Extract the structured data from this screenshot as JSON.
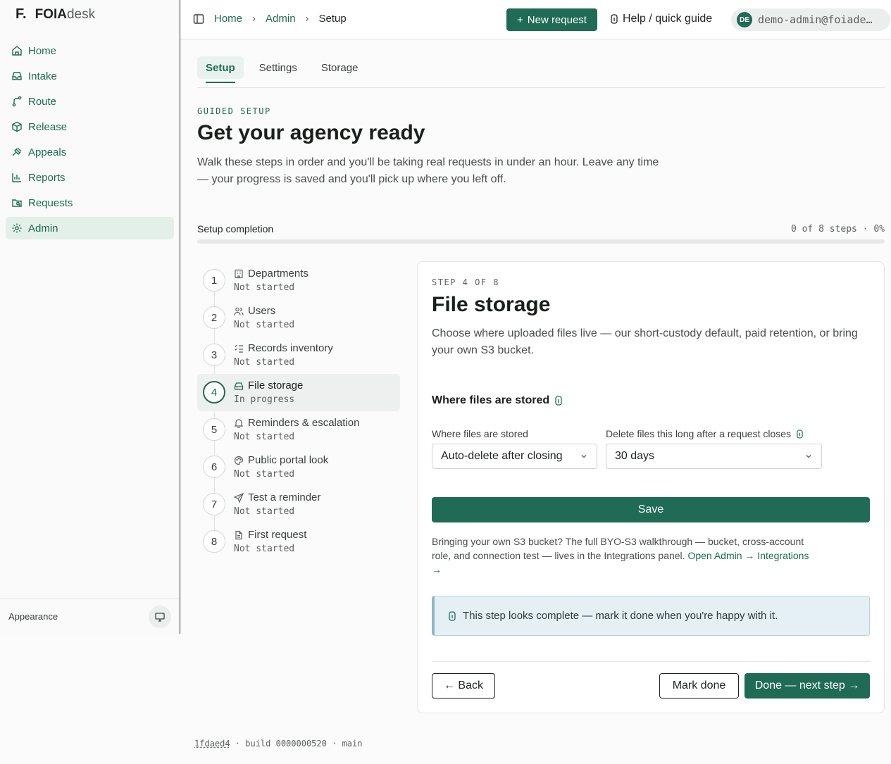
{
  "brand": {
    "mark": "F.",
    "name_bold": "FOIA",
    "name_light": "desk"
  },
  "nav": [
    {
      "label": "Home",
      "icon": "home-icon"
    },
    {
      "label": "Intake",
      "icon": "inbox-icon"
    },
    {
      "label": "Route",
      "icon": "route-icon"
    },
    {
      "label": "Release",
      "icon": "package-icon"
    },
    {
      "label": "Appeals",
      "icon": "gavel-icon"
    },
    {
      "label": "Reports",
      "icon": "bar-chart-icon"
    },
    {
      "label": "Requests",
      "icon": "folder-search-icon"
    },
    {
      "label": "Admin",
      "icon": "gear-icon",
      "active": true
    }
  ],
  "sidebar_footer": {
    "appearance_label": "Appearance"
  },
  "breadcrumb": {
    "home": "Home",
    "admin": "Admin",
    "current": "Setup"
  },
  "topbar": {
    "new_request": "New request",
    "help": "Help / quick guide",
    "avatar_initials": "DE",
    "user_email": "demo-admin@foiade…"
  },
  "tabs": [
    {
      "label": "Setup",
      "active": true
    },
    {
      "label": "Settings"
    },
    {
      "label": "Storage"
    }
  ],
  "page": {
    "eyebrow": "GUIDED SETUP",
    "title": "Get your agency ready",
    "lead": "Walk these steps in order and you'll be taking real requests in under an hour. Leave any time — your progress is saved and you'll pick up where you left off."
  },
  "progress": {
    "label": "Setup completion",
    "count_text": "0 of 8 steps · 0%",
    "fraction": 0
  },
  "steps": [
    {
      "num": "1",
      "label": "Departments",
      "state": "Not started",
      "icon": "building-icon"
    },
    {
      "num": "2",
      "label": "Users",
      "state": "Not started",
      "icon": "users-icon"
    },
    {
      "num": "3",
      "label": "Records inventory",
      "state": "Not started",
      "icon": "list-checks-icon"
    },
    {
      "num": "4",
      "label": "File storage",
      "state": "In progress",
      "icon": "hard-drive-icon",
      "current": true
    },
    {
      "num": "5",
      "label": "Reminders & escalation",
      "state": "Not started",
      "icon": "bell-icon"
    },
    {
      "num": "6",
      "label": "Public portal look",
      "state": "Not started",
      "icon": "palette-icon"
    },
    {
      "num": "7",
      "label": "Test a reminder",
      "state": "Not started",
      "icon": "send-icon"
    },
    {
      "num": "8",
      "label": "First request",
      "state": "Not started",
      "icon": "file-text-icon"
    }
  ],
  "panel": {
    "eyebrow": "STEP 4 OF 8",
    "title": "File storage",
    "lead": "Choose where uploaded files live — our short-custody default, paid retention, or bring your own S3 bucket.",
    "section_title": "Where files are stored",
    "storage_label": "Where files are stored",
    "storage_value": "Auto-delete after closing",
    "delete_label": "Delete files this long after a request closes",
    "delete_value": "30 days",
    "save": "Save",
    "byo_text": "Bringing your own S3 bucket? The full BYO-S3 walkthrough — bucket, cross-account role, and connection test — lives in the Integrations panel.",
    "byo_link": "Open Admin → Integrations →",
    "callout": "This step looks complete — mark it done when you're happy with it.",
    "back": "← Back",
    "mark_done": "Mark done",
    "next": "Done — next step →"
  },
  "build": {
    "hash": "1fdaed4",
    "rest": " · build 0000000520 · main"
  }
}
